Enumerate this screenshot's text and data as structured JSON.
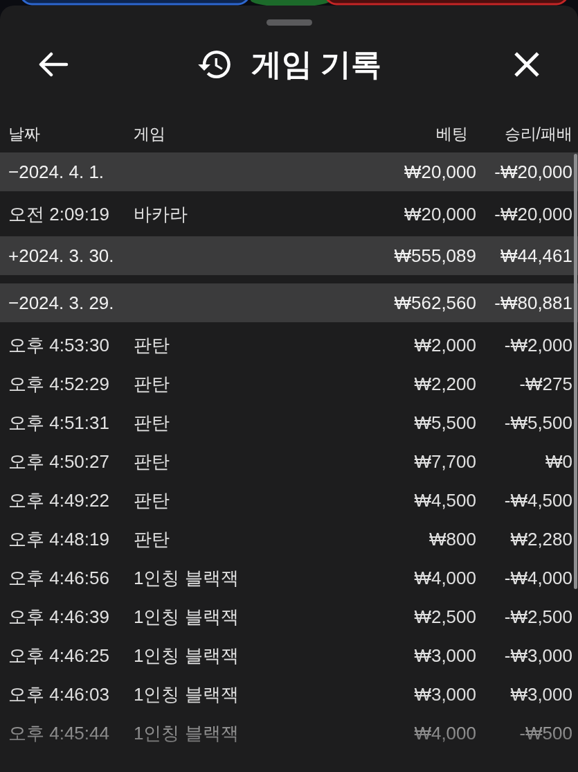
{
  "sheet": {
    "title": "게임 기록"
  },
  "table": {
    "columns": [
      "날짜",
      "게임",
      "베팅",
      "승리/패배"
    ],
    "groups": [
      {
        "toggle": "−",
        "date": "2024. 4. 1.",
        "bet": "₩20,000",
        "result": "-₩20,000",
        "children": [
          {
            "time": "오전 2:09:19",
            "game": "바카라",
            "bet": "₩20,000",
            "result": "-₩20,000"
          }
        ]
      },
      {
        "toggle": "+",
        "date": "2024. 3. 30.",
        "bet": "₩555,089",
        "result": "₩44,461"
      },
      {
        "toggle": "−",
        "date": "2024. 3. 29.",
        "bet": "₩562,560",
        "result": "-₩80,881",
        "children": [
          {
            "time": "오후 4:53:30",
            "game": "판탄",
            "bet": "₩2,000",
            "result": "-₩2,000"
          },
          {
            "time": "오후 4:52:29",
            "game": "판탄",
            "bet": "₩2,200",
            "result": "-₩275"
          },
          {
            "time": "오후 4:51:31",
            "game": "판탄",
            "bet": "₩5,500",
            "result": "-₩5,500"
          },
          {
            "time": "오후 4:50:27",
            "game": "판탄",
            "bet": "₩7,700",
            "result": "₩0"
          },
          {
            "time": "오후 4:49:22",
            "game": "판탄",
            "bet": "₩4,500",
            "result": "-₩4,500"
          },
          {
            "time": "오후 4:48:19",
            "game": "판탄",
            "bet": "₩800",
            "result": "₩2,280"
          },
          {
            "time": "오후 4:46:56",
            "game": "1인칭 블랙잭",
            "bet": "₩4,000",
            "result": "-₩4,000"
          },
          {
            "time": "오후 4:46:39",
            "game": "1인칭 블랙잭",
            "bet": "₩2,500",
            "result": "-₩2,500"
          },
          {
            "time": "오후 4:46:25",
            "game": "1인칭 블랙잭",
            "bet": "₩3,000",
            "result": "-₩3,000"
          },
          {
            "time": "오후 4:46:03",
            "game": "1인칭 블랙잭",
            "bet": "₩3,000",
            "result": "₩3,000"
          },
          {
            "time": "오후 4:45:44",
            "game": "1인칭 블랙잭",
            "bet": "₩4,000",
            "result": "-₩500"
          }
        ]
      }
    ]
  }
}
